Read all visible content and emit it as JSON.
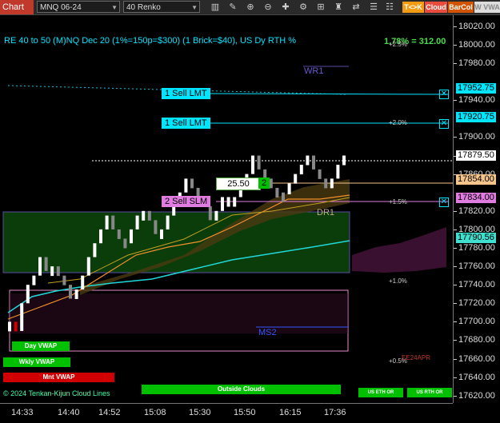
{
  "toolbar": {
    "chart_label": "Chart",
    "instrument": "MNQ 06-24",
    "bar_type": "40 Renko",
    "buttons": {
      "tk": "T<>K",
      "cloud": "Cloud",
      "barcol": "BarCol",
      "wvwap": "W VWA"
    },
    "icons": [
      "bar-style-icon",
      "draw-icon",
      "crosshair-icon",
      "zoom-in-icon",
      "zoom-out-icon",
      "properties-icon",
      "indicators-icon",
      "strategies-icon",
      "chart-trader-icon",
      "data-box-icon"
    ]
  },
  "chart": {
    "title": "RE 40 to 50 (M)NQ Dec 20 (1%=150p=$300) (1 Brick=$40), US Dy RTH %",
    "pct_change": "1.78% = 312.00",
    "y_ticks": [
      "18020.00",
      "18000.00",
      "17980.00",
      "17940.00",
      "17900.00",
      "17880.00",
      "17860.00",
      "17820.00",
      "17800.00",
      "17780.00",
      "17760.00",
      "17740.00",
      "17720.00",
      "17700.00",
      "17680.00",
      "17660.00",
      "17640.00",
      "17620.00"
    ],
    "y_min": 17612,
    "y_max": 18032,
    "price_labels": [
      {
        "value": "17952.75",
        "color": "#00e5ff"
      },
      {
        "value": "17920.75",
        "color": "#00e5ff"
      },
      {
        "value": "17879.50",
        "color": "#ffffff"
      },
      {
        "value": "17854.00",
        "color": "#f5c48a"
      },
      {
        "value": "17834.00",
        "color": "#e07ce0"
      },
      {
        "value": "17790.56",
        "color": "#40e0d0"
      }
    ],
    "x_ticks": [
      "14:33",
      "14:40",
      "14:52",
      "15:08",
      "15:30",
      "15:50",
      "16:15",
      "17:36"
    ],
    "orders": {
      "sell_lmt_1": "1 Sell LMT",
      "sell_lmt_2": "1 Sell LMT",
      "sell_slm": "2 Sell SLM",
      "qty_value": "25.50",
      "qty_count": "2"
    },
    "levels": {
      "wr1": "WR1",
      "dr1": "DR1",
      "ms2": "MS2"
    },
    "pct_levels": {
      "p25": "+2.5%",
      "p20": "+2.0%",
      "p15": "+1.5%",
      "p10": "+1.0%",
      "p05": "+0.5%"
    },
    "annotations": {
      "ee": "EE24APR"
    },
    "vwaps": {
      "day": "Day VWAP",
      "wkly": "Wkly VWAP",
      "mnt": "Mnt VWAP"
    },
    "bottom": {
      "credits": "© 2024 Tenkan-Kijun Cloud Lines",
      "outside": "Outside Clouds",
      "us_eth": "US ETH OR",
      "us_rth": "US RTH OR"
    }
  },
  "chart_data": {
    "type": "renko",
    "instrument": "MNQ 06-24",
    "brick_size": 40,
    "y_range": [
      17612,
      18032
    ],
    "x_labels": [
      "14:33",
      "14:40",
      "14:52",
      "15:08",
      "15:30",
      "15:50",
      "16:15",
      "17:36"
    ],
    "last_price": 17879.5,
    "levels": {
      "sell_lmt_1": 17952.75,
      "sell_lmt_2": 17920.75,
      "entry": 17854.0,
      "stop": 17834.0,
      "vwap_line": 17790.56
    },
    "bricks_close": [
      17700,
      17690,
      17720,
      17740,
      17750,
      17770,
      17755,
      17760,
      17750,
      17740,
      17725,
      17735,
      17750,
      17770,
      17785,
      17800,
      17815,
      17800,
      17790,
      17785,
      17800,
      17815,
      17820,
      17810,
      17795,
      17800,
      17815,
      17830,
      17840,
      17855,
      17845,
      17835,
      17825,
      17810,
      17820,
      17835,
      17835,
      17835,
      17850,
      17860,
      17880,
      17865,
      17855,
      17845,
      17840,
      17838,
      17850,
      17860,
      17870,
      17880,
      17865,
      17855,
      17845,
      17855,
      17870,
      17880
    ]
  }
}
